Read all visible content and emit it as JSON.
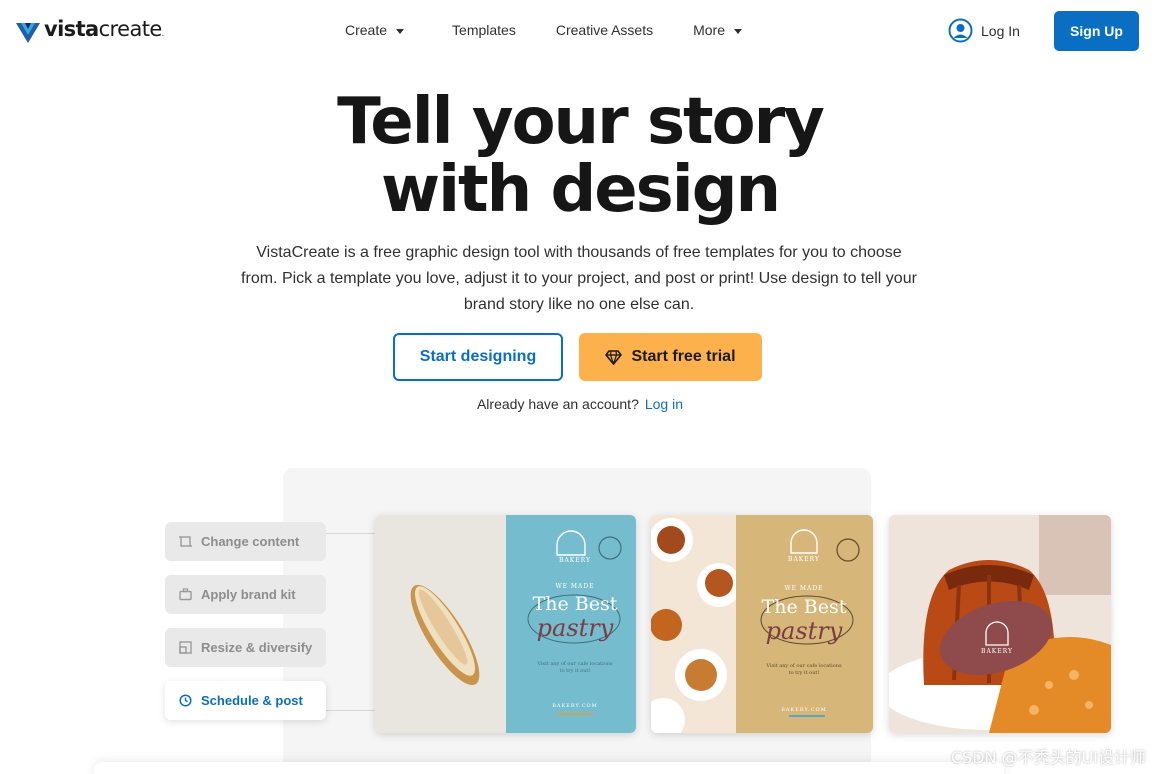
{
  "brand": {
    "logo_bold": "vista",
    "logo_thin": "create",
    "accent": "#0a6fc2",
    "cta": "#fdb14c"
  },
  "nav": {
    "items": [
      {
        "label": "Create",
        "has_dropdown": true
      },
      {
        "label": "Templates",
        "has_dropdown": false
      },
      {
        "label": "Creative Assets",
        "has_dropdown": false
      },
      {
        "label": "More",
        "has_dropdown": true
      }
    ],
    "login_label": "Log In",
    "signup_label": "Sign Up"
  },
  "hero": {
    "title_line1": "Tell your story",
    "title_line2": "with design",
    "subtitle": "VistaCreate is a free graphic design tool with thousands of free templates for you to choose from. Pick a template you love, adjust it to your project, and post or print! Use design to tell your brand story like no one else can.",
    "primary_button": "Start designing",
    "trial_button": "Start free trial",
    "account_prompt": "Already have an account?",
    "account_link": "Log in"
  },
  "features": [
    {
      "label": "Change content",
      "icon": "crop-icon",
      "active": false
    },
    {
      "label": "Apply brand kit",
      "icon": "briefcase-icon",
      "active": false
    },
    {
      "label": "Resize & diversify",
      "icon": "resize-icon",
      "active": false
    },
    {
      "label": "Schedule & post",
      "icon": "clock-icon",
      "active": true
    }
  ],
  "templates": {
    "brand_small": "BAKERY",
    "kicker": "WE MADE",
    "headline": "The Best",
    "script": "pastry",
    "blurb": "Visit any of our cafe locations to try it out!",
    "url": "BAKERY.COM"
  },
  "watermark": "CSDN @不秃头的UI设计师"
}
